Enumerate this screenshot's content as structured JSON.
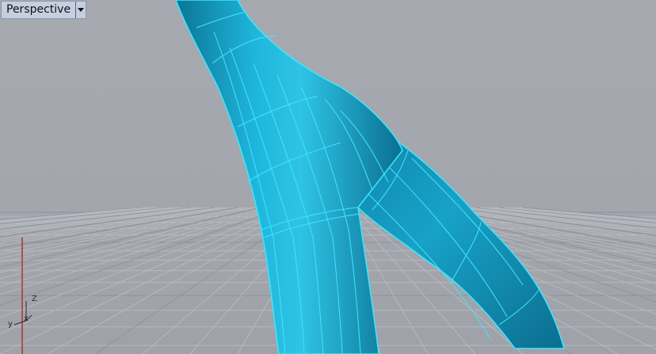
{
  "viewport": {
    "name": "Perspective",
    "menu_icon": "chevron-down-icon"
  },
  "axes": {
    "z_label": "Z",
    "x_label": "x",
    "y_label": "y"
  },
  "colors": {
    "background": "#a3a6ad",
    "grid_minor": "#b6b9bf",
    "grid_major": "#8f939a",
    "surface": "#1ba6cc",
    "surface_dark": "#0f7c9e",
    "edge": "#3ee6ff",
    "axis_red": "#b03030",
    "tab_bg": "#c6cfe0"
  }
}
